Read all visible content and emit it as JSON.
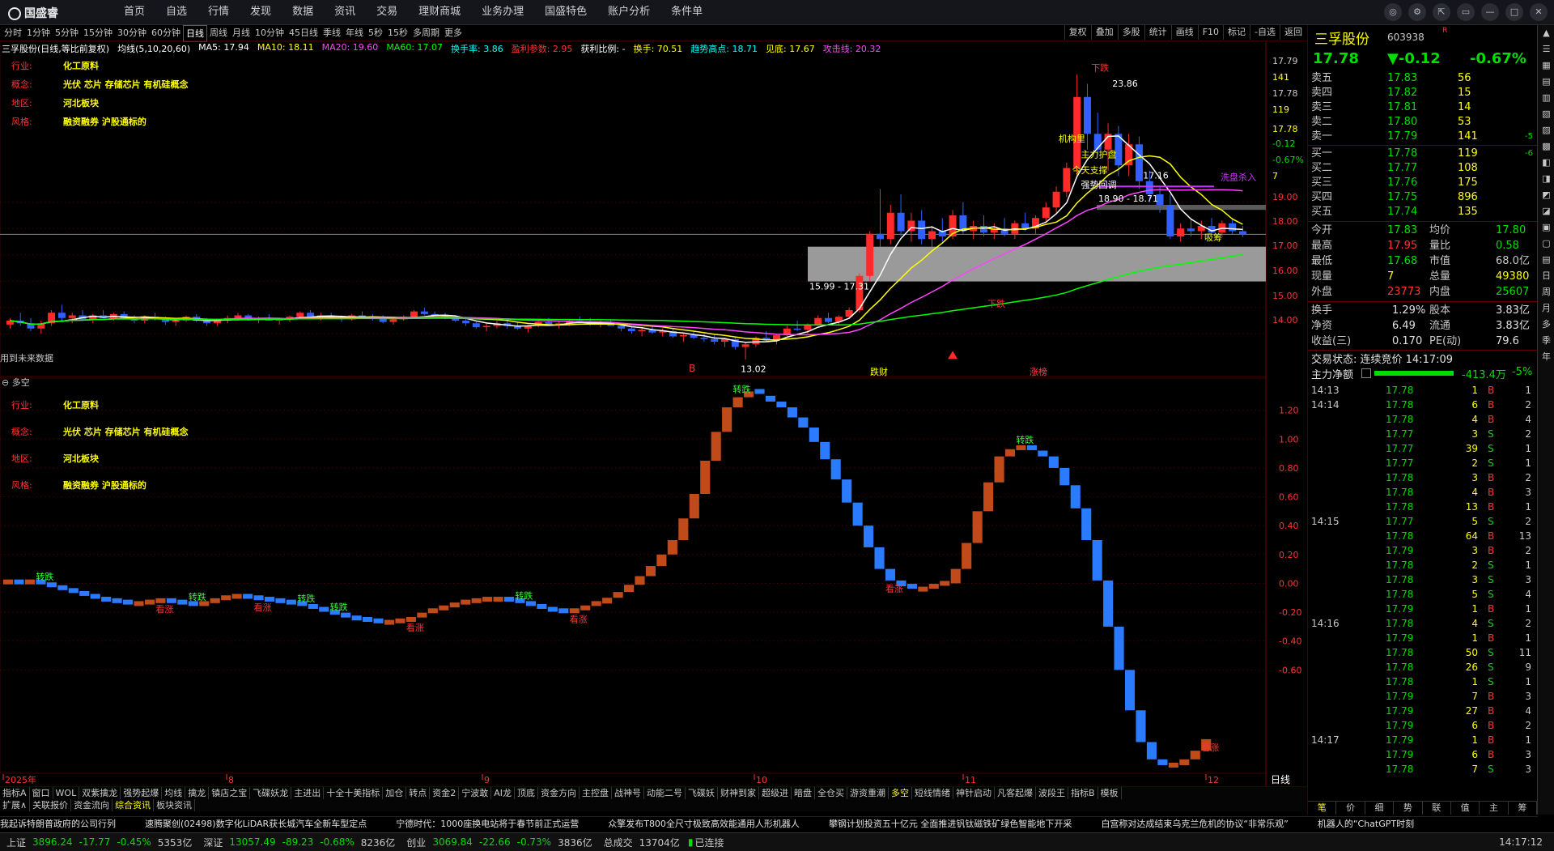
{
  "app": {
    "logo": "国盛睿",
    "menu": [
      "首页",
      "自选",
      "行情",
      "发现",
      "数据",
      "资讯",
      "交易",
      "理财商城",
      "业务办理",
      "国盛特色",
      "账户分析",
      "条件单"
    ],
    "window_buttons": [
      "chat-icon",
      "settings-icon",
      "share-icon",
      "restore-icon",
      "minimize-icon",
      "maximize-icon",
      "close-icon"
    ]
  },
  "periods": [
    "分时",
    "1分钟",
    "5分钟",
    "15分钟",
    "30分钟",
    "60分钟",
    "日线",
    "周线",
    "月线",
    "10分钟",
    "45日线",
    "季线",
    "年线",
    "5秒",
    "15秒",
    "多周期",
    "更多"
  ],
  "active_period": "日线",
  "tools": [
    "复权",
    "叠加",
    "多股",
    "统计",
    "画线",
    "F10",
    "标记",
    "-自选",
    "返回"
  ],
  "chart_header": {
    "name": "三孚股份(日线,等比前复权)",
    "ma_label": "均线(5,10,20,60)",
    "items": [
      {
        "text": "MA5: 17.94",
        "color": "#ffffff"
      },
      {
        "text": "MA10: 18.11",
        "color": "#ffff00"
      },
      {
        "text": "MA20: 19.60",
        "color": "#ff44ff"
      },
      {
        "text": "MA60: 17.07",
        "color": "#00ff00"
      },
      {
        "text": "换手率: 3.86",
        "color": "#00ffff"
      },
      {
        "text": "盈利参数: 2.95",
        "color": "#ff3333"
      },
      {
        "text": "获利比例: - ",
        "color": "#ffffff"
      },
      {
        "text": "换手: 70.51",
        "color": "#ffff00"
      },
      {
        "text": "趋势高点: 18.71",
        "color": "#00ffff"
      },
      {
        "text": "见底: 17.67",
        "color": "#ffff00"
      },
      {
        "text": "攻击线: 20.32",
        "color": "#ff44ff"
      }
    ]
  },
  "info": [
    {
      "label": "行业:",
      "value": "化工原料"
    },
    {
      "label": "概念:",
      "value": "光伏 芯片 存储芯片 有机硅概念"
    },
    {
      "label": "地区:",
      "value": "河北板块"
    },
    {
      "label": "风格:",
      "value": "融资融券 沪股通标的"
    }
  ],
  "labels": {
    "future_data": "用到未来数据",
    "indicator_title": "多空",
    "period_corner": "日线",
    "xiapan": "下跌",
    "bottom_a": "跌财",
    "bottom_b": "涨榜",
    "zone_upper": "18.90 - 18.71",
    "zone_lower": "15.99 - 17.31",
    "peak": "23.86",
    "trough": "13.02",
    "wash": "洗盘杀入",
    "buy_tag": "吸筹",
    "mid_tags": [
      "机构里",
      "主力护盘",
      "今天支撑",
      "强势回调"
    ],
    "price_17_16": "17.16",
    "ind_up": "转跌",
    "ind_down": "看涨"
  },
  "price_axis": {
    "ticks": [
      {
        "label": "17.79",
        "color": "#c8c8c8"
      },
      {
        "label": "141",
        "color": "#ffff00"
      },
      {
        "label": "17.78",
        "color": "#c8c8c8"
      },
      {
        "label": "119",
        "color": "#ffff00"
      },
      {
        "label": "17.78",
        "color": "#ffff00"
      },
      {
        "label": "-0.12",
        "color": "#00dd00"
      },
      {
        "label": "-0.67%",
        "color": "#00dd00"
      },
      {
        "label": "7",
        "color": "#ffff00"
      },
      {
        "label": "19.00",
        "color": "#ff3333"
      },
      {
        "label": "18.00",
        "color": "#ff3333"
      },
      {
        "label": "17.00",
        "color": "#ff3333"
      },
      {
        "label": "16.00",
        "color": "#ff3333"
      },
      {
        "label": "15.00",
        "color": "#ff3333"
      },
      {
        "label": "14.00",
        "color": "#ff3333"
      }
    ]
  },
  "ind_axis": [
    "1.20",
    "1.00",
    "0.80",
    "0.60",
    "0.40",
    "0.20",
    "0.00",
    "-0.20",
    "-0.40",
    "-0.60"
  ],
  "x_axis": [
    "2025年",
    "8",
    "9",
    "10",
    "11",
    "12"
  ],
  "bottom_tabs1": [
    "指标A",
    "窗口",
    "WOL",
    "双紫擒龙",
    "强势起爆",
    "均线",
    "擒龙",
    "镇店之宝",
    "飞碟妖龙",
    "主进出",
    "十全十美指标",
    "加仓",
    "转点",
    "资金2",
    "宁波敢",
    "AI龙",
    "顶底",
    "资金方向",
    "主控盘",
    "战神号",
    "动能二号",
    "飞碟妖",
    "财神到家",
    "超级进",
    "暗盘",
    "全仓买",
    "游资重潮",
    "多空",
    "短线情绪",
    "神针启动",
    "凡客起爆",
    "波段王",
    "指标B",
    "模板"
  ],
  "bottom_tabs1_active": "多空",
  "bottom_tabs2": [
    "扩展∧",
    "关联报价",
    "资金流向",
    "综合资讯",
    "板块资讯"
  ],
  "bottom_tabs2_active": "综合资讯",
  "news": [
    "我起诉特朗普政府的公司行列",
    "速腾聚创(02498)数字化LiDAR获长城汽车全新车型定点",
    "宁德时代：1000座换电站将于春节前正式运营",
    "众擎发布T800全尺寸极致高效能通用人形机器人",
    "攀钢计划投资五十亿元 全面推进钒钛磁铁矿绿色智能地下开采",
    "白宫称对达成结束乌克兰危机的协议“非常乐观”",
    "机器人的“ChatGPT时刻"
  ],
  "status": {
    "sh_label": "上证",
    "sh": "3896.24",
    "sh_chg": "-17.77",
    "sh_pct": "-0.45%",
    "sh_amt": "5353亿",
    "sz_label": "深证",
    "sz": "13057.49",
    "sz_chg": "-89.23",
    "sz_pct": "-0.68%",
    "sz_amt": "8236亿",
    "cy_label": "创业",
    "cy": "3069.84",
    "cy_chg": "-22.66",
    "cy_pct": "-0.73%",
    "cy_amt": "3836亿",
    "total_label": "总成交",
    "total": "13704亿",
    "conn": "已连接",
    "time": "14:17:12"
  },
  "quote": {
    "name": "三孚股份",
    "code": "603938",
    "mark": "R",
    "price": "17.78",
    "chg": "▼-0.12",
    "pct": "-0.67%",
    "asks": [
      {
        "label": "卖五",
        "price": "17.83",
        "vol": "56",
        "diff": ""
      },
      {
        "label": "卖四",
        "price": "17.82",
        "vol": "15",
        "diff": ""
      },
      {
        "label": "卖三",
        "price": "17.81",
        "vol": "14",
        "diff": ""
      },
      {
        "label": "卖二",
        "price": "17.80",
        "vol": "53",
        "diff": ""
      },
      {
        "label": "卖一",
        "price": "17.79",
        "vol": "141",
        "diff": "-5"
      }
    ],
    "bids": [
      {
        "label": "买一",
        "price": "17.78",
        "vol": "119",
        "diff": "-6"
      },
      {
        "label": "买二",
        "price": "17.77",
        "vol": "108",
        "diff": ""
      },
      {
        "label": "买三",
        "price": "17.76",
        "vol": "175",
        "diff": ""
      },
      {
        "label": "买四",
        "price": "17.75",
        "vol": "896",
        "diff": ""
      },
      {
        "label": "买五",
        "price": "17.74",
        "vol": "135",
        "diff": ""
      }
    ],
    "stats": [
      {
        "l1": "今开",
        "v1": "17.83",
        "c1": "#00dd00",
        "l2": "均价",
        "v2": "17.80",
        "c2": "#00dd00"
      },
      {
        "l1": "最高",
        "v1": "17.95",
        "c1": "#ff3333",
        "l2": "量比",
        "v2": "0.58",
        "c2": "#00dd00"
      },
      {
        "l1": "最低",
        "v1": "17.68",
        "c1": "#00dd00",
        "l2": "市值",
        "v2": "68.0亿",
        "c2": "#c8c8c8"
      },
      {
        "l1": "现量",
        "v1": "7",
        "c1": "#ffff00",
        "l2": "总量",
        "v2": "49380",
        "c2": "#ffff00"
      },
      {
        "l1": "外盘",
        "v1": "23773",
        "c1": "#ff3333",
        "l2": "内盘",
        "v2": "25607",
        "c2": "#00dd00"
      }
    ],
    "stats2": [
      {
        "l1": "换手",
        "v1": "1.29%",
        "l2": "股本",
        "v2": "3.83亿"
      },
      {
        "l1": "净资",
        "v1": "6.49",
        "l2": "流通",
        "v2": "3.83亿"
      },
      {
        "l1": "收益(三)",
        "v1": "0.170",
        "l2": "PE(动)",
        "v2": "79.6"
      }
    ],
    "trade_status": "交易状态: 连续竞价 14:17:09",
    "net_label": "主力净额",
    "net_value": "-413.4万",
    "net_pct": "-5%"
  },
  "ticks": [
    {
      "t": "14:13",
      "p": "17.78",
      "v": "1",
      "s": "B",
      "n": "1"
    },
    {
      "t": "14:14",
      "p": "17.78",
      "v": "6",
      "s": "B",
      "n": "2"
    },
    {
      "t": "",
      "p": "17.78",
      "v": "4",
      "s": "B",
      "n": "4"
    },
    {
      "t": "",
      "p": "17.77",
      "v": "3",
      "s": "S",
      "n": "2"
    },
    {
      "t": "",
      "p": "17.77",
      "v": "39",
      "s": "S",
      "n": "1"
    },
    {
      "t": "",
      "p": "17.77",
      "v": "2",
      "s": "S",
      "n": "1"
    },
    {
      "t": "",
      "p": "17.78",
      "v": "3",
      "s": "B",
      "n": "2"
    },
    {
      "t": "",
      "p": "17.78",
      "v": "4",
      "s": "B",
      "n": "3"
    },
    {
      "t": "",
      "p": "17.78",
      "v": "13",
      "s": "B",
      "n": "1"
    },
    {
      "t": "14:15",
      "p": "17.77",
      "v": "5",
      "s": "S",
      "n": "2"
    },
    {
      "t": "",
      "p": "17.78",
      "v": "64",
      "s": "B",
      "n": "13"
    },
    {
      "t": "",
      "p": "17.79",
      "v": "3",
      "s": "B",
      "n": "2"
    },
    {
      "t": "",
      "p": "17.78",
      "v": "2",
      "s": "S",
      "n": "1"
    },
    {
      "t": "",
      "p": "17.78",
      "v": "3",
      "s": "S",
      "n": "3"
    },
    {
      "t": "",
      "p": "17.78",
      "v": "5",
      "s": "S",
      "n": "4"
    },
    {
      "t": "",
      "p": "17.79",
      "v": "1",
      "s": "B",
      "n": "1"
    },
    {
      "t": "14:16",
      "p": "17.78",
      "v": "4",
      "s": "S",
      "n": "2"
    },
    {
      "t": "",
      "p": "17.79",
      "v": "1",
      "s": "B",
      "n": "1"
    },
    {
      "t": "",
      "p": "17.78",
      "v": "50",
      "s": "S",
      "n": "11"
    },
    {
      "t": "",
      "p": "17.78",
      "v": "26",
      "s": "S",
      "n": "9"
    },
    {
      "t": "",
      "p": "17.78",
      "v": "1",
      "s": "S",
      "n": "1"
    },
    {
      "t": "",
      "p": "17.79",
      "v": "7",
      "s": "B",
      "n": "3"
    },
    {
      "t": "",
      "p": "17.79",
      "v": "27",
      "s": "B",
      "n": "4"
    },
    {
      "t": "",
      "p": "17.79",
      "v": "6",
      "s": "B",
      "n": "2"
    },
    {
      "t": "14:17",
      "p": "17.79",
      "v": "1",
      "s": "B",
      "n": "1"
    },
    {
      "t": "",
      "p": "17.79",
      "v": "6",
      "s": "B",
      "n": "3"
    },
    {
      "t": "",
      "p": "17.78",
      "v": "7",
      "s": "S",
      "n": "3"
    }
  ],
  "rp_tabs": [
    "笔",
    "价",
    "细",
    "势",
    "联",
    "值",
    "主",
    "筹"
  ],
  "rp_tabs_active": "笔",
  "sidebar": [
    "▲",
    "☰",
    "▦",
    "▤",
    "▥",
    "▧",
    "▨",
    "▩",
    "◧",
    "◨",
    "◩",
    "◪",
    "▣",
    "▢",
    "▤",
    "日",
    "周",
    "月",
    "多",
    "季",
    "年"
  ],
  "candles": [
    [
      14.35,
      14.6,
      14.2,
      14.5
    ],
    [
      14.5,
      14.8,
      14.3,
      14.4
    ],
    [
      14.4,
      14.6,
      14.1,
      14.2
    ],
    [
      14.2,
      14.5,
      14.0,
      14.4
    ],
    [
      14.4,
      14.9,
      14.3,
      14.8
    ],
    [
      14.8,
      15.1,
      14.5,
      14.6
    ],
    [
      14.6,
      14.8,
      14.4,
      14.7
    ],
    [
      14.7,
      14.9,
      14.5,
      14.55
    ],
    [
      14.55,
      14.75,
      14.4,
      14.7
    ],
    [
      14.7,
      14.9,
      14.6,
      14.6
    ],
    [
      14.6,
      14.8,
      14.5,
      14.75
    ],
    [
      14.75,
      14.85,
      14.55,
      14.6
    ],
    [
      14.6,
      14.7,
      14.4,
      14.5
    ],
    [
      14.5,
      14.7,
      14.4,
      14.65
    ],
    [
      14.65,
      14.8,
      14.5,
      14.55
    ],
    [
      14.55,
      14.65,
      14.35,
      14.45
    ],
    [
      14.45,
      14.6,
      14.3,
      14.5
    ],
    [
      14.5,
      14.7,
      14.45,
      14.65
    ],
    [
      14.65,
      14.75,
      14.45,
      14.5
    ],
    [
      14.5,
      14.6,
      14.3,
      14.4
    ],
    [
      14.4,
      14.55,
      14.3,
      14.5
    ],
    [
      14.5,
      14.7,
      14.4,
      14.6
    ],
    [
      14.6,
      14.8,
      14.5,
      14.7
    ],
    [
      14.7,
      14.75,
      14.5,
      14.55
    ],
    [
      14.55,
      14.65,
      14.4,
      14.6
    ],
    [
      14.6,
      14.75,
      14.5,
      14.5
    ],
    [
      14.5,
      14.6,
      14.35,
      14.55
    ],
    [
      14.55,
      14.7,
      14.45,
      14.65
    ],
    [
      14.65,
      14.85,
      14.6,
      14.8
    ],
    [
      14.8,
      14.9,
      14.6,
      14.65
    ],
    [
      14.65,
      14.8,
      14.5,
      14.7
    ],
    [
      14.7,
      14.8,
      14.55,
      14.6
    ],
    [
      14.6,
      14.7,
      14.45,
      14.55
    ],
    [
      14.55,
      14.75,
      14.5,
      14.7
    ],
    [
      14.7,
      14.85,
      14.6,
      14.65
    ],
    [
      14.65,
      14.75,
      14.5,
      14.6
    ],
    [
      14.6,
      14.7,
      14.4,
      14.45
    ],
    [
      14.45,
      14.6,
      14.35,
      14.55
    ],
    [
      14.55,
      14.7,
      14.5,
      14.65
    ],
    [
      14.65,
      14.9,
      14.6,
      14.85
    ],
    [
      14.85,
      15.0,
      14.7,
      14.75
    ],
    [
      14.75,
      14.85,
      14.6,
      14.7
    ],
    [
      14.7,
      14.8,
      14.55,
      14.6
    ],
    [
      14.6,
      14.7,
      14.45,
      14.5
    ],
    [
      14.5,
      14.6,
      14.3,
      14.4
    ],
    [
      14.4,
      14.5,
      14.2,
      14.25
    ],
    [
      14.25,
      14.4,
      14.1,
      14.3
    ],
    [
      14.3,
      14.5,
      14.2,
      14.4
    ],
    [
      14.4,
      14.5,
      14.2,
      14.3
    ],
    [
      14.3,
      14.45,
      14.15,
      14.2
    ],
    [
      14.2,
      14.35,
      14.05,
      14.3
    ],
    [
      14.3,
      14.5,
      14.25,
      14.45
    ],
    [
      14.45,
      14.6,
      14.3,
      14.35
    ],
    [
      14.35,
      14.5,
      14.2,
      14.4
    ],
    [
      14.4,
      14.55,
      14.3,
      14.5
    ],
    [
      14.5,
      14.65,
      14.4,
      14.45
    ],
    [
      14.45,
      14.6,
      14.3,
      14.35
    ],
    [
      14.35,
      14.5,
      14.25,
      14.4
    ],
    [
      14.4,
      14.55,
      14.3,
      14.3
    ],
    [
      14.3,
      14.4,
      14.1,
      14.2
    ],
    [
      14.2,
      14.3,
      14.0,
      14.1
    ],
    [
      14.1,
      14.25,
      13.9,
      14.15
    ],
    [
      14.15,
      14.3,
      14.0,
      14.05
    ],
    [
      14.05,
      14.2,
      13.9,
      14.1
    ],
    [
      14.1,
      14.2,
      13.85,
      13.9
    ],
    [
      13.9,
      14.05,
      13.7,
      13.95
    ],
    [
      13.95,
      14.1,
      13.8,
      13.85
    ],
    [
      13.85,
      14.0,
      13.7,
      13.8
    ],
    [
      13.8,
      13.95,
      13.6,
      13.7
    ],
    [
      13.7,
      13.85,
      13.5,
      13.8
    ],
    [
      13.8,
      13.9,
      13.4,
      13.5
    ],
    [
      13.5,
      13.7,
      13.02,
      13.6
    ],
    [
      13.6,
      13.9,
      13.5,
      13.85
    ],
    [
      13.85,
      14.1,
      13.7,
      13.75
    ],
    [
      13.75,
      14.0,
      13.6,
      13.95
    ],
    [
      13.95,
      14.3,
      13.9,
      14.2
    ],
    [
      14.2,
      14.5,
      14.1,
      14.15
    ],
    [
      14.15,
      14.4,
      14.0,
      14.35
    ],
    [
      14.35,
      14.7,
      14.3,
      14.6
    ],
    [
      14.6,
      14.8,
      14.4,
      14.45
    ],
    [
      14.45,
      14.7,
      14.3,
      14.65
    ],
    [
      14.65,
      15.0,
      14.6,
      14.9
    ],
    [
      14.9,
      16.3,
      14.8,
      16.2
    ],
    [
      16.2,
      17.9,
      16.0,
      17.8
    ],
    [
      17.8,
      19.5,
      17.3,
      17.6
    ],
    [
      17.6,
      18.9,
      17.4,
      18.6
    ],
    [
      18.6,
      19.3,
      17.7,
      17.9
    ],
    [
      17.9,
      18.6,
      17.5,
      18.3
    ],
    [
      18.3,
      18.7,
      17.4,
      17.6
    ],
    [
      17.6,
      18.1,
      17.3,
      17.9
    ],
    [
      17.9,
      18.4,
      17.5,
      17.7
    ],
    [
      17.7,
      18.7,
      17.6,
      18.5
    ],
    [
      18.5,
      19.0,
      17.8,
      17.9
    ],
    [
      17.9,
      18.3,
      17.6,
      18.1
    ],
    [
      18.1,
      18.5,
      17.7,
      17.85
    ],
    [
      17.85,
      18.2,
      17.6,
      18.0
    ],
    [
      18.0,
      18.4,
      17.7,
      17.8
    ],
    [
      17.8,
      18.3,
      17.6,
      18.2
    ],
    [
      18.2,
      18.6,
      17.9,
      18.0
    ],
    [
      18.0,
      18.5,
      17.8,
      18.4
    ],
    [
      18.4,
      19.0,
      18.2,
      18.8
    ],
    [
      18.8,
      19.6,
      18.6,
      19.4
    ],
    [
      19.4,
      20.5,
      19.2,
      20.3
    ],
    [
      20.3,
      23.86,
      20.0,
      23.0
    ],
    [
      23.0,
      23.5,
      21.0,
      21.6
    ],
    [
      21.6,
      22.4,
      20.8,
      21.0
    ],
    [
      21.0,
      22.0,
      20.2,
      21.6
    ],
    [
      21.6,
      21.9,
      20.0,
      20.4
    ],
    [
      20.4,
      21.6,
      20.0,
      21.2
    ],
    [
      21.2,
      21.5,
      19.5,
      19.8
    ],
    [
      19.8,
      20.2,
      19.0,
      19.3
    ],
    [
      19.3,
      19.6,
      18.6,
      18.9
    ],
    [
      18.9,
      19.3,
      17.6,
      17.7
    ],
    [
      17.7,
      18.2,
      17.5,
      18.0
    ],
    [
      18.0,
      18.4,
      17.7,
      17.9
    ],
    [
      17.9,
      18.3,
      17.6,
      18.1
    ],
    [
      18.1,
      18.4,
      17.8,
      17.85
    ],
    [
      17.85,
      18.3,
      17.7,
      18.2
    ],
    [
      18.2,
      18.4,
      17.8,
      17.9
    ],
    [
      17.9,
      18.1,
      17.68,
      17.78
    ]
  ],
  "indicator": [
    0.01,
    0.0,
    0.01,
    -0.01,
    -0.03,
    -0.05,
    -0.07,
    -0.09,
    -0.11,
    -0.12,
    -0.13,
    -0.14,
    -0.14,
    -0.13,
    -0.12,
    -0.13,
    -0.14,
    -0.15,
    -0.14,
    -0.12,
    -0.1,
    -0.09,
    -0.1,
    -0.11,
    -0.12,
    -0.13,
    -0.14,
    -0.16,
    -0.18,
    -0.2,
    -0.22,
    -0.24,
    -0.25,
    -0.26,
    -0.27,
    -0.27,
    -0.26,
    -0.25,
    -0.22,
    -0.19,
    -0.17,
    -0.15,
    -0.13,
    -0.12,
    -0.11,
    -0.11,
    -0.12,
    -0.14,
    -0.16,
    -0.18,
    -0.19,
    -0.2,
    -0.19,
    -0.17,
    -0.14,
    -0.1,
    -0.06,
    -0.01,
    0.05,
    0.12,
    0.2,
    0.3,
    0.45,
    0.62,
    0.85,
    1.05,
    1.22,
    1.29,
    1.33,
    1.3,
    1.26,
    1.22,
    1.15,
    1.08,
    0.98,
    0.86,
    0.72,
    0.56,
    0.4,
    0.25,
    0.1,
    0.02,
    -0.02,
    -0.04,
    -0.04,
    -0.02,
    0.0,
    0.1,
    0.28,
    0.5,
    0.7,
    0.88,
    0.93,
    0.94,
    0.92,
    0.88,
    0.8,
    0.68,
    0.52,
    0.3,
    0.02,
    -0.3,
    -0.6,
    -0.88,
    -1.1,
    -1.22,
    -1.26,
    -1.26,
    -1.22,
    -1.16,
    -1.08
  ],
  "ma": {
    "ma5_color": "#ffffff",
    "ma10_color": "#ffff00",
    "ma20_color": "#ff44ff",
    "ma60_color": "#00ff00"
  }
}
